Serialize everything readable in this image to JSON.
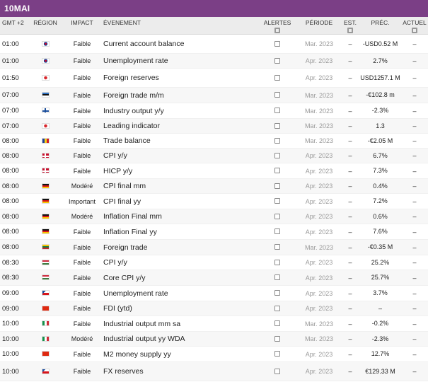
{
  "title": "10MAI",
  "columns": {
    "time": "GMT +2",
    "region": "RÉGION",
    "impact": "IMPACT",
    "event": "ÉVENEMENT",
    "alerts": "ALERTES",
    "period": "PÉRIODE",
    "est": "EST.",
    "prev": "PRÉC.",
    "actual": "ACTUEL"
  },
  "rows": [
    {
      "time": "01:00",
      "flag": "kr",
      "impact": "Faible",
      "event": "Current account balance",
      "period": "Mar. 2023",
      "est": "–",
      "prev": "-USD0.52 M",
      "actual": "–",
      "h": 27
    },
    {
      "time": "01:00",
      "flag": "kr",
      "impact": "Faible",
      "event": "Unemployment rate",
      "period": "Apr. 2023",
      "est": "–",
      "prev": "2.7%",
      "actual": "–",
      "h": 21
    },
    {
      "time": "01:50",
      "flag": "jp",
      "impact": "Faible",
      "event": "Foreign reserves",
      "period": "Apr. 2023",
      "est": "–",
      "prev": "USD1257.1 M",
      "actual": "–",
      "h": 27
    },
    {
      "time": "07:00",
      "flag": "ee",
      "impact": "Faible",
      "event": "Foreign trade m/m",
      "period": "Mar. 2023",
      "est": "–",
      "prev": "-€102.8 m",
      "actual": "–",
      "h": 22
    },
    {
      "time": "07:00",
      "flag": "fi",
      "impact": "Faible",
      "event": "Industry output y/y",
      "period": "Mar. 2023",
      "est": "–",
      "prev": "-2.3%",
      "actual": "–",
      "h": 22
    },
    {
      "time": "07:00",
      "flag": "jp",
      "impact": "Faible",
      "event": "Leading indicator",
      "period": "Mar. 2023",
      "est": "–",
      "prev": "1.3",
      "actual": "–",
      "h": 21
    },
    {
      "time": "08:00",
      "flag": "ro",
      "impact": "Faible",
      "event": "Trade balance",
      "period": "Mar. 2023",
      "est": "–",
      "prev": "-€2.05 M",
      "actual": "–",
      "h": 21
    },
    {
      "time": "08:00",
      "flag": "dk",
      "impact": "Faible",
      "event": "CPI y/y",
      "period": "Apr. 2023",
      "est": "–",
      "prev": "6.7%",
      "actual": "–",
      "h": 21
    },
    {
      "time": "08:00",
      "flag": "dk",
      "impact": "Faible",
      "event": "HICP y/y",
      "period": "Apr. 2023",
      "est": "–",
      "prev": "7.3%",
      "actual": "–",
      "h": 22
    },
    {
      "time": "08:00",
      "flag": "de",
      "impact": "Modéré",
      "event": "CPI final mm",
      "period": "Apr. 2023",
      "est": "–",
      "prev": "0.4%",
      "actual": "–",
      "h": 21
    },
    {
      "time": "08:00",
      "flag": "de",
      "impact": "Important",
      "event": "CPI final yy",
      "period": "Apr. 2023",
      "est": "–",
      "prev": "7.2%",
      "actual": "–",
      "h": 22
    },
    {
      "time": "08:00",
      "flag": "de",
      "impact": "Modéré",
      "event": "Inflation Final mm",
      "period": "Apr. 2023",
      "est": "–",
      "prev": "0.6%",
      "actual": "–",
      "h": 21
    },
    {
      "time": "08:00",
      "flag": "de",
      "impact": "Faible",
      "event": "Inflation Final yy",
      "period": "Apr. 2023",
      "est": "–",
      "prev": "7.6%",
      "actual": "–",
      "h": 22
    },
    {
      "time": "08:00",
      "flag": "lt",
      "impact": "Faible",
      "event": "Foreign trade",
      "period": "Mar. 2023",
      "est": "–",
      "prev": "-€0.35 M",
      "actual": "–",
      "h": 22
    },
    {
      "time": "08:30",
      "flag": "hu",
      "impact": "Faible",
      "event": "CPI y/y",
      "period": "Apr. 2023",
      "est": "–",
      "prev": "25.2%",
      "actual": "–",
      "h": 21
    },
    {
      "time": "08:30",
      "flag": "hu",
      "impact": "Faible",
      "event": "Core CPI y/y",
      "period": "Apr. 2023",
      "est": "–",
      "prev": "25.7%",
      "actual": "–",
      "h": 22
    },
    {
      "time": "09:00",
      "flag": "cz",
      "impact": "Faible",
      "event": "Unemployment rate",
      "period": "Apr. 2023",
      "est": "–",
      "prev": "3.7%",
      "actual": "–",
      "h": 22
    },
    {
      "time": "09:00",
      "flag": "cn",
      "impact": "Faible",
      "event": "FDI (ytd)",
      "period": "Apr. 2023",
      "est": "–",
      "prev": "–",
      "actual": "–",
      "h": 21
    },
    {
      "time": "10:00",
      "flag": "it",
      "impact": "Faible",
      "event": "Industrial output mm sa",
      "period": "Mar. 2023",
      "est": "–",
      "prev": "-0.2%",
      "actual": "–",
      "h": 22
    },
    {
      "time": "10:00",
      "flag": "it",
      "impact": "Modéré",
      "event": "Industrial output yy WDA",
      "period": "Mar. 2023",
      "est": "–",
      "prev": "-2.3%",
      "actual": "–",
      "h": 21
    },
    {
      "time": "10:00",
      "flag": "cn",
      "impact": "Faible",
      "event": "M2 money supply yy",
      "period": "Apr. 2023",
      "est": "–",
      "prev": "12.7%",
      "actual": "–",
      "h": 22
    },
    {
      "time": "10:00",
      "flag": "cz",
      "impact": "Faible",
      "event": "FX reserves",
      "period": "Apr. 2023",
      "est": "–",
      "prev": "€129.33 M",
      "actual": "–",
      "h": 27
    }
  ],
  "colors": {
    "titlebar": "#7b3f86",
    "header": "#ececec"
  }
}
